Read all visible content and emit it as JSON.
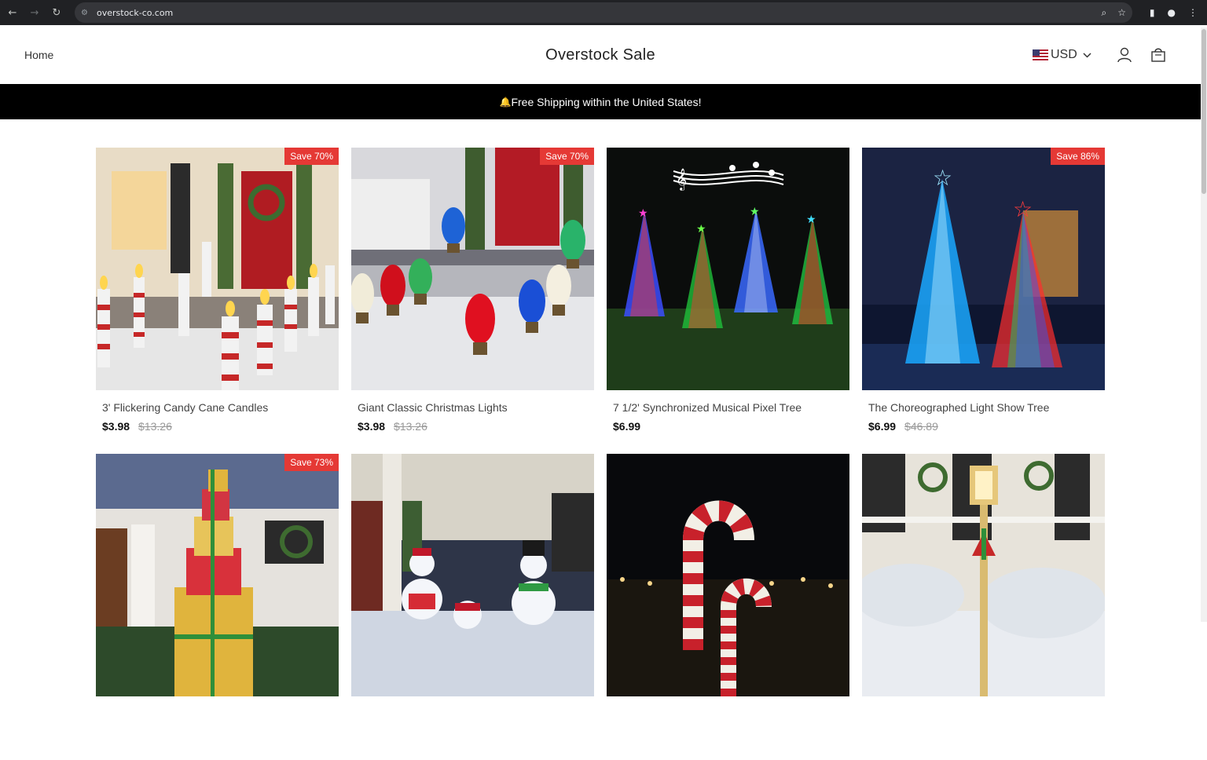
{
  "browser": {
    "url": "overstock-co.com"
  },
  "header": {
    "home_label": "Home",
    "logo_text": "Overstock Sale",
    "currency": "USD"
  },
  "announcement": {
    "emoji": "🔔",
    "text": "Free Shipping within the United States!"
  },
  "products": [
    {
      "title": "3' Flickering Candy Cane Candles",
      "price": "$3.98",
      "compare_price": "$13.26",
      "badge": "Save 70%"
    },
    {
      "title": "Giant Classic Christmas Lights",
      "price": "$3.98",
      "compare_price": "$13.26",
      "badge": "Save 70%"
    },
    {
      "title": "7 1/2' Synchronized Musical Pixel Tree",
      "price": "$6.99",
      "compare_price": "",
      "badge": ""
    },
    {
      "title": "The Choreographed Light Show Tree",
      "price": "$6.99",
      "compare_price": "$46.89",
      "badge": "Save 86%"
    },
    {
      "title": "",
      "price": "",
      "compare_price": "",
      "badge": "Save 73%"
    },
    {
      "title": "",
      "price": "",
      "compare_price": "",
      "badge": ""
    },
    {
      "title": "",
      "price": "",
      "compare_price": "",
      "badge": ""
    },
    {
      "title": "",
      "price": "",
      "compare_price": "",
      "badge": ""
    }
  ]
}
